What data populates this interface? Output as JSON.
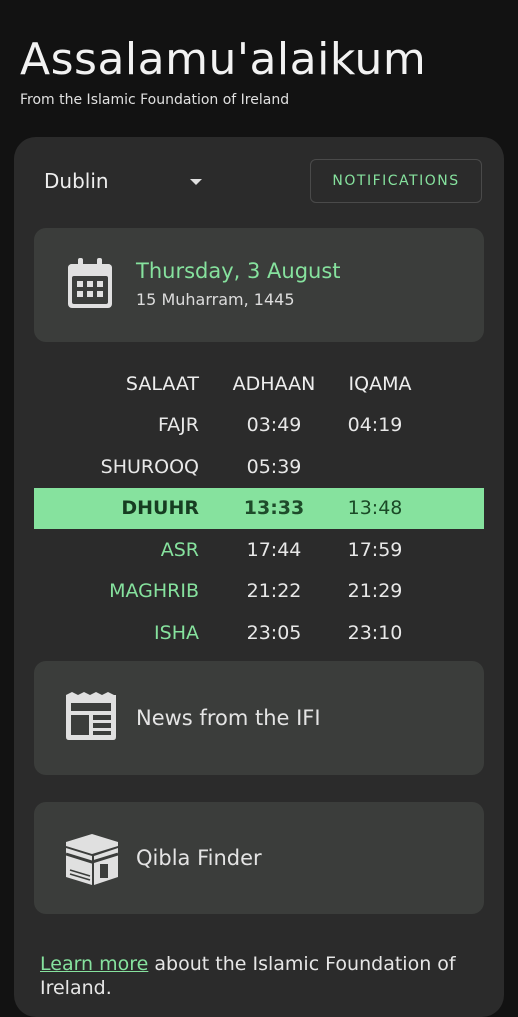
{
  "header": {
    "greeting": "Assalamu'alaikum",
    "subtitle": "From the Islamic Foundation of Ireland"
  },
  "location": {
    "selected": "Dublin",
    "icon": "caret-down-icon"
  },
  "notifications": {
    "label": "NOTIFICATIONS"
  },
  "date": {
    "icon": "calendar-icon",
    "gregorian": "Thursday, 3 August",
    "hijri": "15 Muharram, 1445"
  },
  "prayer_table": {
    "headers": {
      "salaat": "SALAAT",
      "adhaan": "ADHAAN",
      "iqama": "IQAMA"
    },
    "rows": [
      {
        "name": "FAJR",
        "adhaan": "03:49",
        "iqama": "04:19"
      },
      {
        "name": "SHUROOQ",
        "adhaan": "05:39",
        "iqama": ""
      },
      {
        "name": "DHUHR",
        "adhaan": "13:33",
        "iqama": "13:48"
      },
      {
        "name": "ASR",
        "adhaan": "17:44",
        "iqama": "17:59"
      },
      {
        "name": "MAGHRIB",
        "adhaan": "21:22",
        "iqama": "21:29"
      },
      {
        "name": "ISHA",
        "adhaan": "23:05",
        "iqama": "23:10"
      }
    ]
  },
  "news": {
    "icon": "newspaper-icon",
    "label": "News from the IFI"
  },
  "qibla": {
    "icon": "kaaba-icon",
    "label": "Qibla Finder"
  },
  "footer": {
    "link_text": "Learn more",
    "rest_text": " about the Islamic Foundation of Ireland."
  },
  "colors": {
    "accent": "#86e29e",
    "background": "#121212",
    "card": "#2b2b2b",
    "tile": "#3b3d3b"
  }
}
